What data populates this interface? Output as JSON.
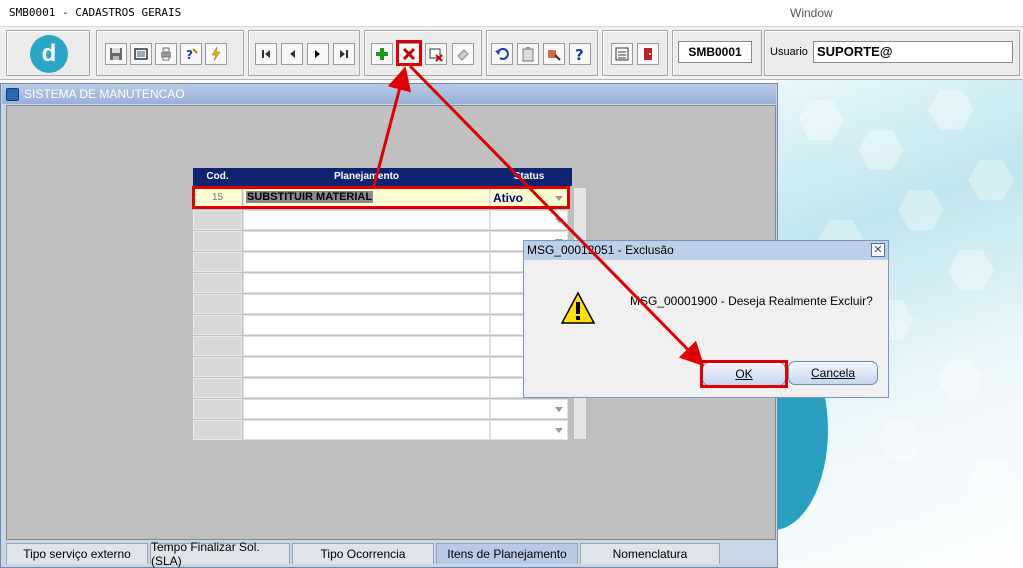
{
  "app": {
    "title": "SMB0001 - CADASTROS GERAIS",
    "window_menu": "Window"
  },
  "toolbar": {
    "logo_letter": "d",
    "form_code": "SMB0001",
    "user_label": "Usuario",
    "user_value": "SUPORTE@",
    "buttons": [
      {
        "name": "save",
        "icon": "floppy-icon"
      },
      {
        "name": "window",
        "icon": "window-icon"
      },
      {
        "name": "print",
        "icon": "printer-icon"
      },
      {
        "name": "query",
        "icon": "query-icon"
      },
      {
        "name": "execute",
        "icon": "lightning-icon"
      },
      {
        "name": "first",
        "icon": "first-record-icon"
      },
      {
        "name": "previous",
        "icon": "previous-record-icon"
      },
      {
        "name": "next",
        "icon": "next-record-icon"
      },
      {
        "name": "last",
        "icon": "last-record-icon"
      },
      {
        "name": "insert",
        "icon": "plus-icon"
      },
      {
        "name": "delete",
        "icon": "delete-x-icon"
      },
      {
        "name": "duplicate",
        "icon": "duplicate-icon"
      },
      {
        "name": "clear",
        "icon": "eraser-icon"
      },
      {
        "name": "undo",
        "icon": "undo-icon"
      },
      {
        "name": "clipboard",
        "icon": "clipboard-icon"
      },
      {
        "name": "tools",
        "icon": "tools-icon"
      },
      {
        "name": "help",
        "icon": "help-icon"
      },
      {
        "name": "menu",
        "icon": "menu-icon"
      },
      {
        "name": "exit",
        "icon": "exit-door-icon"
      }
    ]
  },
  "window": {
    "title": "SISTEMA DE MANUTENCAO"
  },
  "grid": {
    "columns": [
      "Cod.",
      "Planejamento",
      "Status"
    ],
    "rows": [
      {
        "cod": "15",
        "planejamento": "SUBSTITUIR MATERIAL",
        "status": "Ativo"
      }
    ]
  },
  "dialog": {
    "title": "MSG_00012051 - Exclusão",
    "message": "MSG_00001900 - Deseja Realmente Excluir?",
    "ok_label": "OK",
    "cancel_label": "Cancela"
  },
  "tabs": [
    {
      "label": "Tipo serviço externo",
      "active": false
    },
    {
      "label": "Tempo Finalizar Sol. (SLA)",
      "active": false
    },
    {
      "label": "Tipo Ocorrencia",
      "active": false
    },
    {
      "label": "Itens de Planejamento",
      "active": true
    },
    {
      "label": "Nomenclatura",
      "active": false
    }
  ],
  "colors": {
    "annotation": "#e00000",
    "grid_header": "#0e2470",
    "selected_row": "#ffffd0"
  }
}
